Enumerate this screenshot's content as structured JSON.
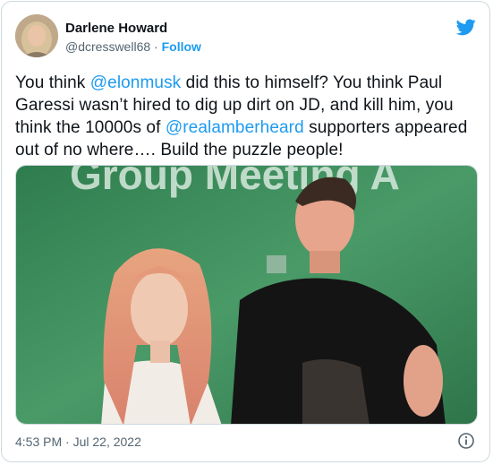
{
  "tweet": {
    "author": {
      "display_name": "Darlene Howard",
      "handle": "@dcresswell68",
      "separator": " · ",
      "follow_label": "Follow"
    },
    "text_parts": {
      "p1": "You think ",
      "m1": "@elonmusk",
      "p2": " did this to himself? You think Paul Garessi wasn’t hired to dig up dirt on JD, and kill him, you think the 10000s of ",
      "m2": "@realamberheard",
      "p3": " supporters appeared out of no where…. Build the puzzle people!"
    },
    "timestamp": "4:53 PM · Jul 22, 2022",
    "photo_background_text": "Group Meeting A",
    "icons": {
      "brand": "twitter-bird-icon",
      "info": "info-icon"
    },
    "colors": {
      "accent": "#1d9bf0",
      "text": "#0f1419",
      "muted": "#536471",
      "border": "#cfd9de"
    }
  }
}
